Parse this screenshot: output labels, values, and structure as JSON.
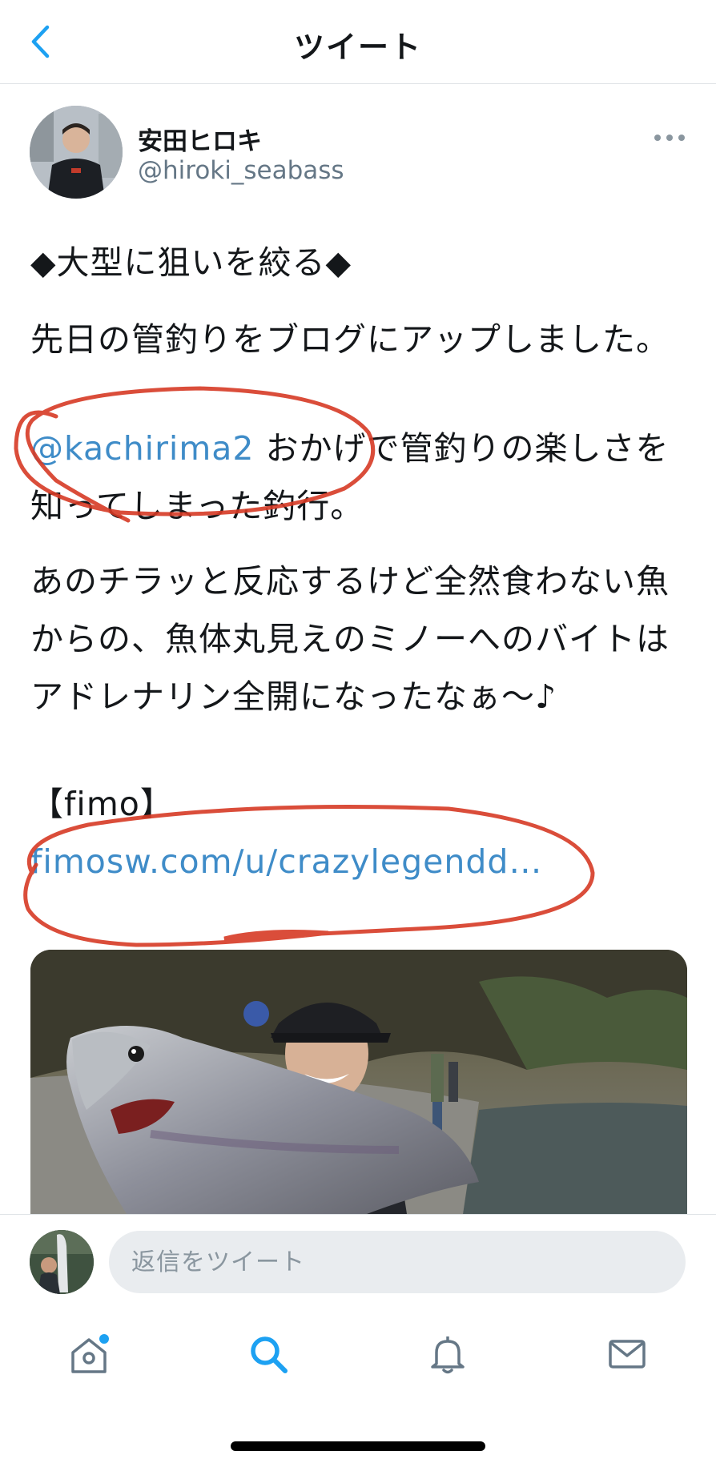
{
  "header": {
    "title": "ツイート",
    "back_icon": "chevron-left-icon"
  },
  "tweet": {
    "author": {
      "name": "安田ヒロキ",
      "handle": "@hiroki_seabass"
    },
    "title": "◆大型に狙いを絞る◆",
    "paragraph1": "先日の管釣りをブログにアップしました。",
    "mention": "@kachirima2",
    "paragraph2_rest": " おかげで管釣りの楽しさを知ってしまった釣行。",
    "paragraph3": "あのチラッと反応するけど全然食わない魚からの、魚体丸見えのミノーへのバイトはアドレナリン全開になったなぁ〜♪",
    "link_label": "【fimo】",
    "link_url": "fimosw.com/u/crazylegendd…"
  },
  "reply": {
    "placeholder": "返信をツイート"
  },
  "tabs": [
    {
      "icon": "home-icon",
      "has_notification_dot": true
    },
    {
      "icon": "search-icon",
      "active": true
    },
    {
      "icon": "bell-icon"
    },
    {
      "icon": "mail-icon"
    }
  ],
  "colors": {
    "link": "#3f8cc8",
    "accent": "#1da1f2",
    "icon_gray": "#657786",
    "annotation": "#d63a25"
  }
}
